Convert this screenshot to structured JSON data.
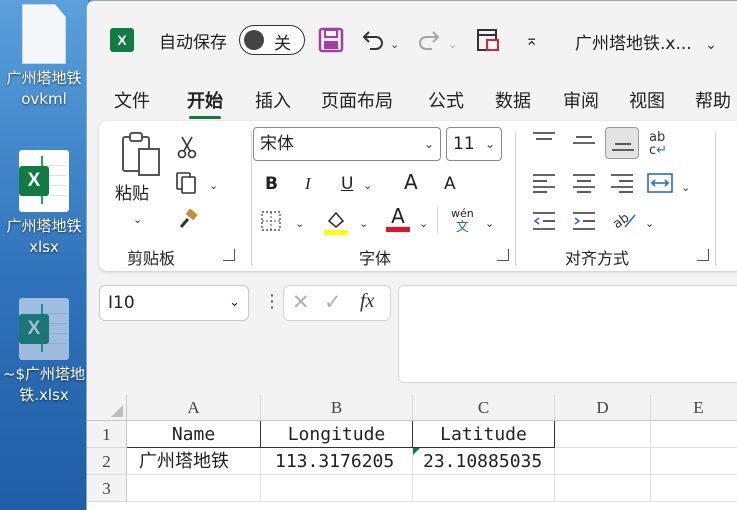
{
  "desktop": {
    "icons": [
      {
        "label": "广州塔地铁.ovkml",
        "line1": "广州塔地铁",
        "line2": "ovkml"
      },
      {
        "label": "广州塔地铁.xlsx",
        "line1": "广州塔地铁",
        "line2": "xlsx"
      },
      {
        "label": "~$广州塔地铁.xlsx",
        "line1": "~$广州塔地",
        "line2": "铁.xlsx"
      }
    ]
  },
  "titlebar": {
    "autosave_label": "自动保存",
    "toggle_state": "关",
    "filename": "广州塔地铁.x...",
    "icons": [
      "excel-logo-icon",
      "save-icon",
      "undo-icon",
      "redo-icon",
      "print-preview-icon",
      "customize-qat-icon"
    ]
  },
  "ribbon_tabs": [
    "文件",
    "开始",
    "插入",
    "页面布局",
    "公式",
    "数据",
    "审阅",
    "视图",
    "帮助"
  ],
  "active_tab": "开始",
  "ribbon": {
    "clipboard": {
      "label": "剪贴板",
      "paste_label": "粘贴"
    },
    "font": {
      "label": "字体",
      "font_name": "宋体",
      "font_size": "11",
      "bold": "B",
      "italic": "I",
      "underline": "U",
      "grow": "A",
      "shrink": "A",
      "phonetic_top": "wén",
      "phonetic_bottom": "文",
      "font_color": "A"
    },
    "alignment": {
      "label": "对齐方式"
    }
  },
  "formula_bar": {
    "name_box": "I10",
    "fx_label": "fx",
    "content": ""
  },
  "sheet": {
    "columns": [
      "A",
      "B",
      "C",
      "D",
      "E"
    ],
    "rows": [
      "1",
      "2",
      "3"
    ],
    "cells": {
      "A1": "Name",
      "B1": "Longitude",
      "C1": "Latitude",
      "A2": "广州塔地铁",
      "B2": "113.3176205",
      "C2": "23.10885035"
    }
  },
  "colors": {
    "accent": "#107c41",
    "highlight": "#ffff00",
    "font_color": "#e81123",
    "desktop": "#3a7ec2"
  }
}
